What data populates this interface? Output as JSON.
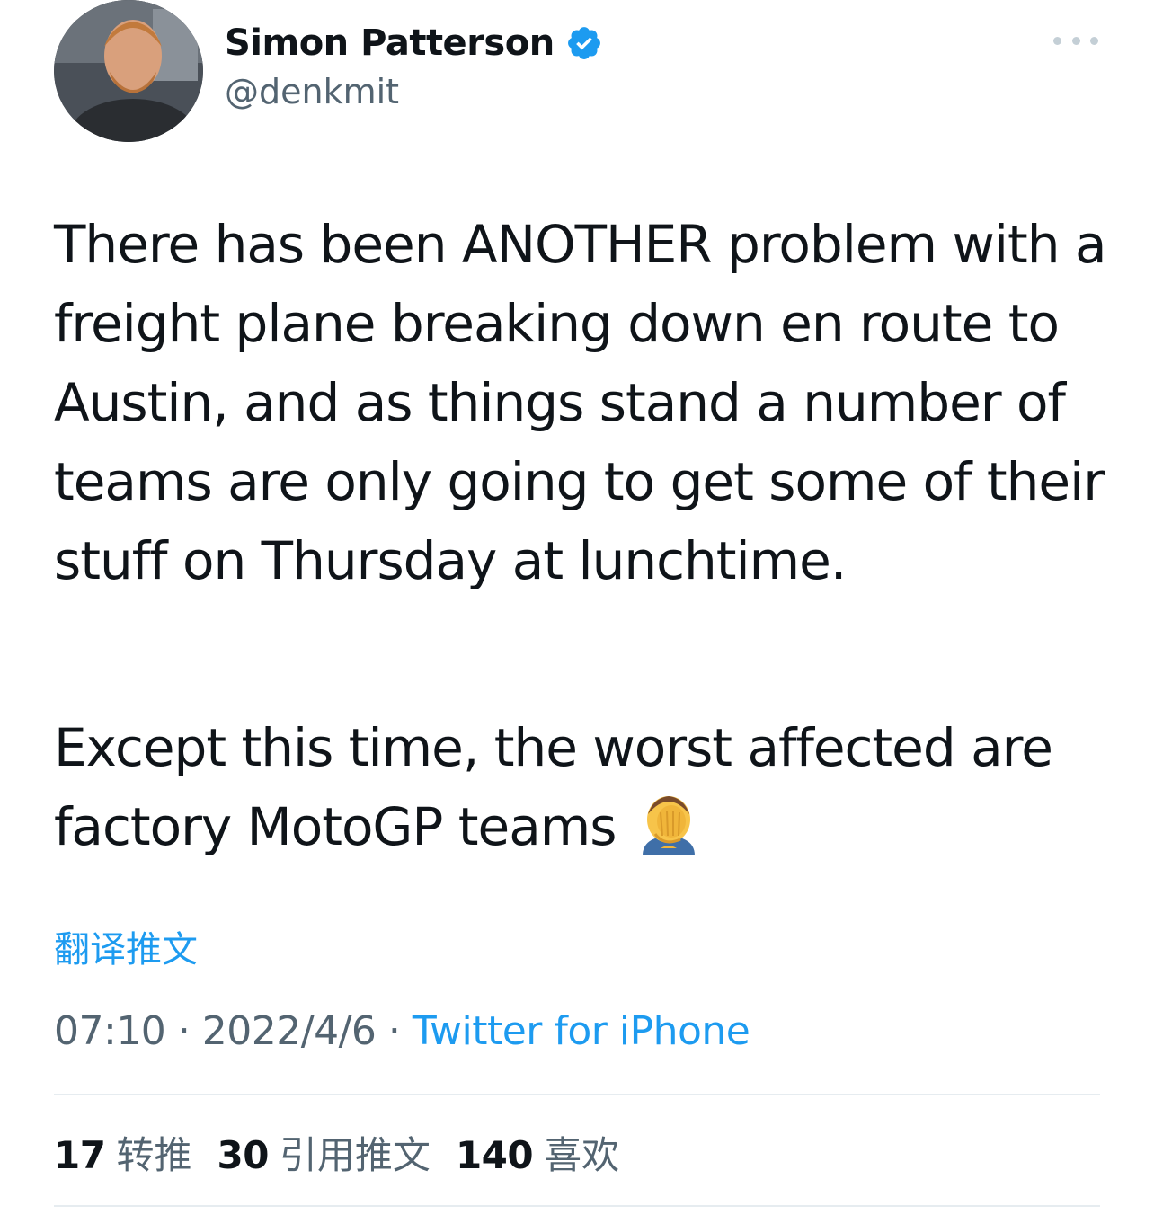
{
  "author": {
    "display_name": "Simon Patterson",
    "handle": "@denkmit",
    "verified": true
  },
  "icons": {
    "avatar": "profile-photo",
    "verified": "verified-badge-icon",
    "more": "more-options-icon",
    "emoji": "face-palm-emoji"
  },
  "tweet": {
    "paragraph_1": "There has been ANOTHER problem with a freight plane breaking down en route to Austin, and as things stand a number of teams are only going to get some of their stuff on Thursday at lunchtime.",
    "paragraph_2": "Except this time, the worst affected are factory MotoGP teams"
  },
  "translate_label": "翻译推文",
  "meta": {
    "time": "07:10",
    "date": "2022/4/6",
    "separator": "·",
    "source": "Twitter for iPhone"
  },
  "stats": {
    "retweets_count": "17",
    "retweets_label": "转推",
    "quotes_count": "30",
    "quotes_label": "引用推文",
    "likes_count": "140",
    "likes_label": "喜欢"
  },
  "colors": {
    "text": "#0f1419",
    "secondary": "#536471",
    "accent": "#1d9bf0",
    "divider": "#e6ecf0"
  }
}
